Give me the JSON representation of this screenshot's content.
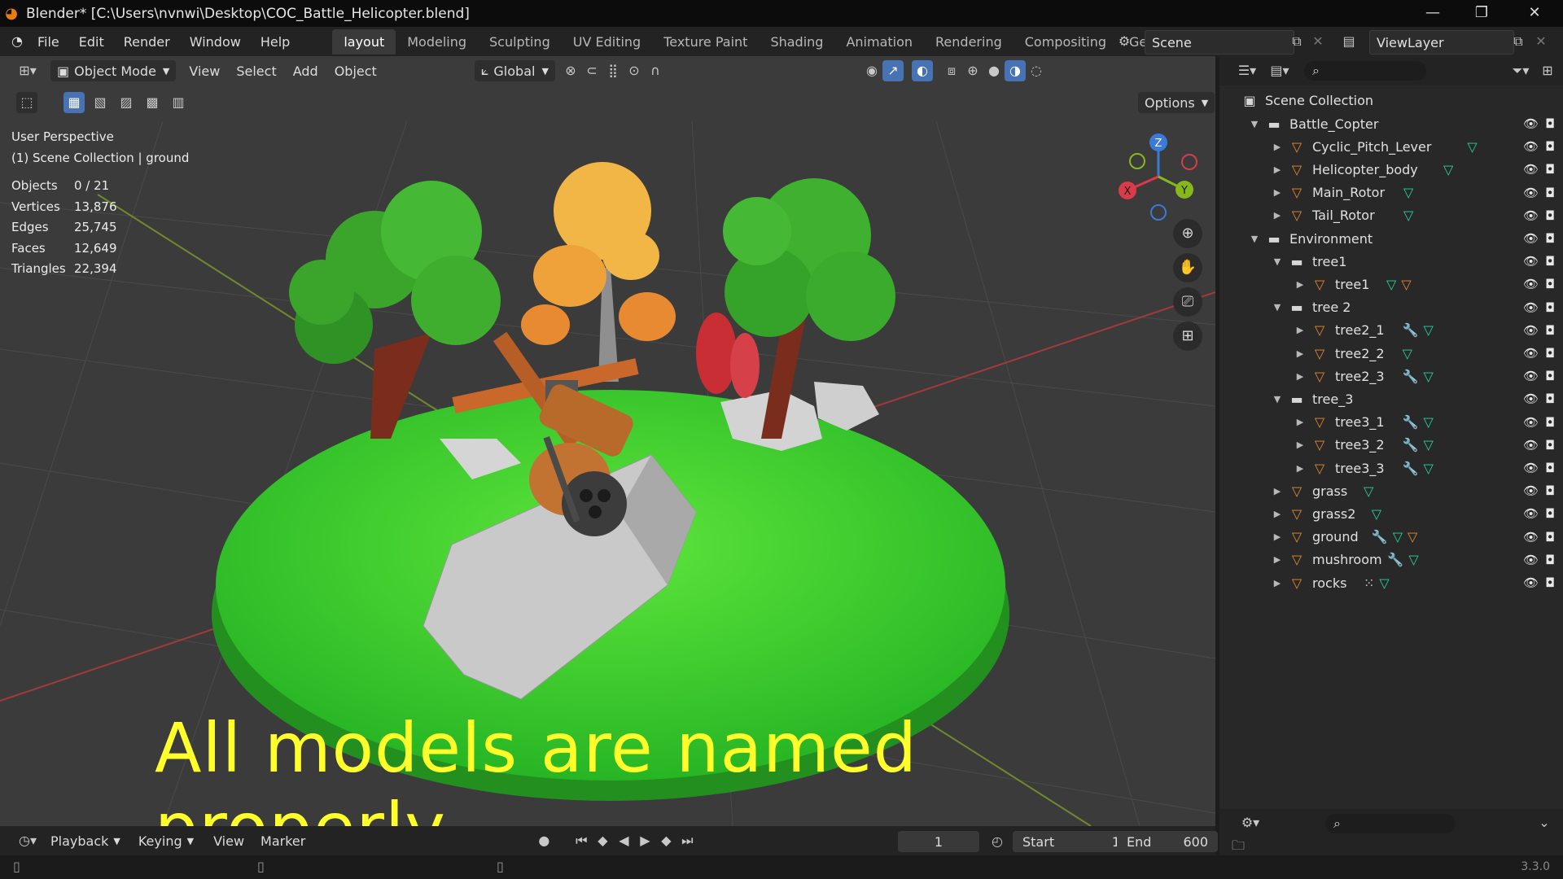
{
  "window": {
    "title": "Blender* [C:\\Users\\nvnwi\\Desktop\\COC_Battle_Helicopter.blend]",
    "controls": [
      "—",
      "❐",
      "✕"
    ]
  },
  "menubar": {
    "menus": [
      "File",
      "Edit",
      "Render",
      "Window",
      "Help"
    ],
    "workspaces": [
      "layout",
      "Modeling",
      "Sculpting",
      "UV Editing",
      "Texture Paint",
      "Shading",
      "Animation",
      "Rendering",
      "Compositing",
      "Geometry Nod"
    ],
    "active_workspace": "layout",
    "scene": "Scene",
    "view_layer": "ViewLayer"
  },
  "viewport": {
    "mode": "Object Mode",
    "menus": [
      "View",
      "Select",
      "Add",
      "Object"
    ],
    "orientation": "Global",
    "options_label": "Options",
    "perspective": "User Perspective",
    "context": "(1) Scene Collection | ground",
    "stats": [
      {
        "label": "Objects",
        "value": "0 / 21"
      },
      {
        "label": "Vertices",
        "value": "13,876"
      },
      {
        "label": "Edges",
        "value": "25,745"
      },
      {
        "label": "Faces",
        "value": "12,649"
      },
      {
        "label": "Triangles",
        "value": "22,394"
      }
    ],
    "gizmo_axes": {
      "z": "Z",
      "x": "X",
      "y": "Y"
    },
    "overlay_caption": "All models are named properly"
  },
  "outliner": {
    "root": "Scene Collection",
    "rows": [
      {
        "name": "Battle_Copter",
        "type": "collection",
        "depth": 0,
        "expanded": true,
        "icons": []
      },
      {
        "name": "Cyclic_Pitch_Lever",
        "type": "mesh",
        "depth": 1,
        "expanded": false,
        "icons": [
          "mesh-data"
        ]
      },
      {
        "name": "Helicopter_body",
        "type": "mesh",
        "depth": 1,
        "expanded": false,
        "icons": [
          "mesh-data"
        ]
      },
      {
        "name": "Main_Rotor",
        "type": "mesh",
        "depth": 1,
        "expanded": false,
        "icons": [
          "mesh-data"
        ]
      },
      {
        "name": "Tail_Rotor",
        "type": "mesh",
        "depth": 1,
        "expanded": false,
        "icons": [
          "mesh-data"
        ]
      },
      {
        "name": "Environment",
        "type": "collection",
        "depth": 0,
        "expanded": true,
        "icons": []
      },
      {
        "name": "tree1",
        "type": "collection",
        "depth": 1,
        "expanded": true,
        "icons": []
      },
      {
        "name": "tree1",
        "type": "mesh",
        "depth": 2,
        "expanded": false,
        "icons": [
          "mesh-data",
          "children-5"
        ]
      },
      {
        "name": "tree 2",
        "type": "collection",
        "depth": 1,
        "expanded": true,
        "icons": []
      },
      {
        "name": "tree2_1",
        "type": "mesh",
        "depth": 2,
        "expanded": false,
        "icons": [
          "modifier",
          "mesh-data"
        ]
      },
      {
        "name": "tree2_2",
        "type": "mesh",
        "depth": 2,
        "expanded": false,
        "icons": [
          "mesh-data"
        ]
      },
      {
        "name": "tree2_3",
        "type": "mesh",
        "depth": 2,
        "expanded": false,
        "icons": [
          "modifier",
          "mesh-data"
        ]
      },
      {
        "name": "tree_3",
        "type": "collection",
        "depth": 1,
        "expanded": true,
        "icons": []
      },
      {
        "name": "tree3_1",
        "type": "mesh",
        "depth": 2,
        "expanded": false,
        "icons": [
          "modifier",
          "mesh-data"
        ]
      },
      {
        "name": "tree3_2",
        "type": "mesh",
        "depth": 2,
        "expanded": false,
        "icons": [
          "modifier",
          "mesh-data"
        ]
      },
      {
        "name": "tree3_3",
        "type": "mesh",
        "depth": 2,
        "expanded": false,
        "icons": [
          "modifier",
          "mesh-data"
        ]
      },
      {
        "name": "grass",
        "type": "mesh",
        "depth": 1,
        "expanded": false,
        "icons": [
          "mesh-data"
        ]
      },
      {
        "name": "grass2",
        "type": "mesh",
        "depth": 1,
        "expanded": false,
        "icons": [
          "mesh-data"
        ]
      },
      {
        "name": "ground",
        "type": "mesh",
        "depth": 1,
        "expanded": false,
        "icons": [
          "modifier",
          "mesh-data",
          "children-9"
        ]
      },
      {
        "name": "mushroom",
        "type": "mesh",
        "depth": 1,
        "expanded": false,
        "icons": [
          "modifier",
          "mesh-data"
        ]
      },
      {
        "name": "rocks",
        "type": "mesh",
        "depth": 1,
        "expanded": false,
        "icons": [
          "particles",
          "mesh-data"
        ]
      }
    ]
  },
  "timeline": {
    "menus": [
      "Playback",
      "Keying",
      "View",
      "Marker"
    ],
    "current_frame": "1",
    "start_label": "Start",
    "start": "1",
    "end_label": "End",
    "end": "600"
  },
  "statusbar": {
    "version": "3.3.0"
  },
  "colors": {
    "accent": "#4772b3",
    "overlay_text": "#ffff2b",
    "mesh_icon": "#e68a2e",
    "data_icon": "#25d3a3",
    "grass": "#3ec92a"
  }
}
